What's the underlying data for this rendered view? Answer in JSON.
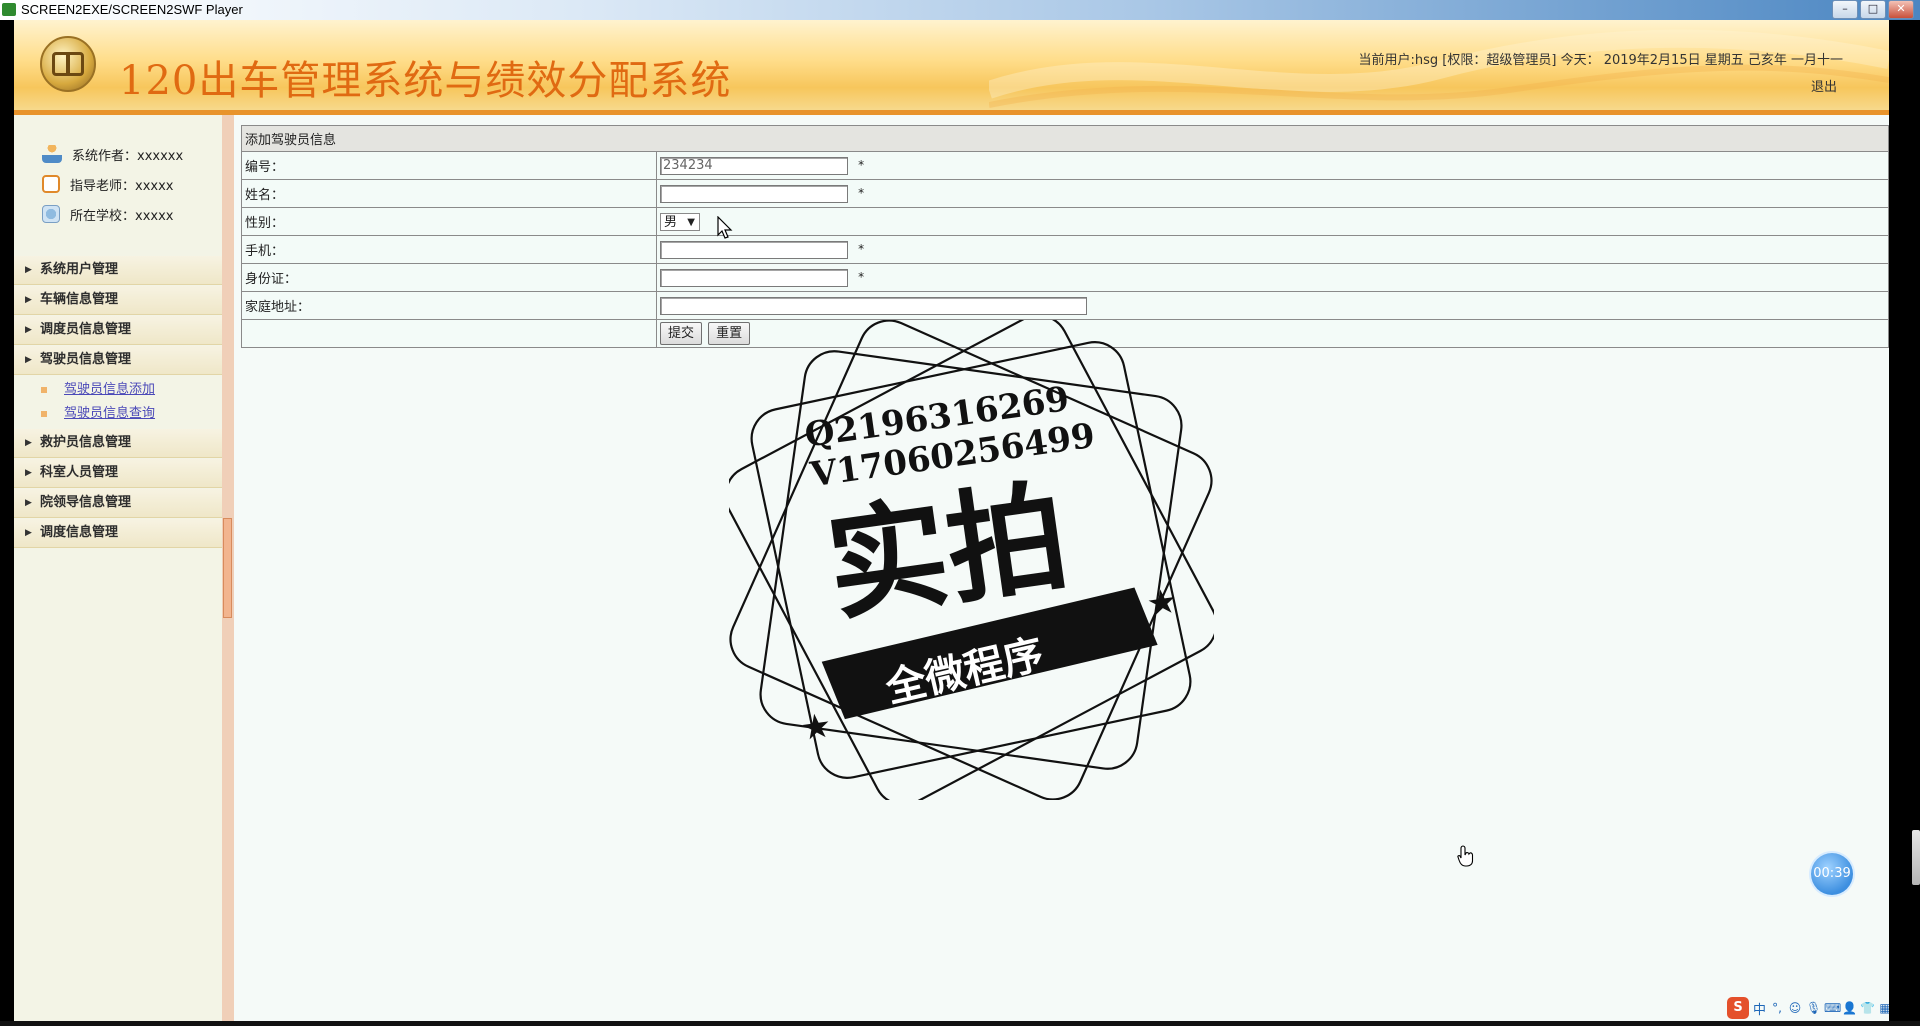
{
  "window": {
    "title": "SCREEN2EXE/SCREEN2SWF Player",
    "controls": {
      "minimize": "–",
      "maximize": "□",
      "close": "✕"
    }
  },
  "header": {
    "app_title": "120出车管理系统与绩效分配系统",
    "user_info": "当前用户:hsg [权限：超级管理员] 今天： 2019年2月15日 星期五 己亥年 一月十一",
    "logout": "退出"
  },
  "sidebar": {
    "info": [
      {
        "label": "系统作者：xxxxxx",
        "icon": "user-icon"
      },
      {
        "label": "指导老师：xxxxx",
        "icon": "alarm-clock-icon"
      },
      {
        "label": "所在学校：xxxxx",
        "icon": "globe-icon"
      }
    ],
    "menu": [
      {
        "label": "系统用户管理"
      },
      {
        "label": "车辆信息管理"
      },
      {
        "label": "调度员信息管理"
      },
      {
        "label": "驾驶员信息管理",
        "expanded": true,
        "children": [
          {
            "label": "驾驶员信息添加"
          },
          {
            "label": "驾驶员信息查询"
          }
        ]
      },
      {
        "label": "救护员信息管理"
      },
      {
        "label": "科室人员管理"
      },
      {
        "label": "院领导信息管理"
      },
      {
        "label": "调度信息管理"
      }
    ]
  },
  "form": {
    "title": "添加驾驶员信息",
    "fields": {
      "number": {
        "label": "编号：",
        "value": "234234",
        "required": "*"
      },
      "name": {
        "label": "姓名：",
        "value": "",
        "required": "*"
      },
      "gender": {
        "label": "性别：",
        "selected": "男"
      },
      "phone": {
        "label": "手机：",
        "value": "",
        "required": "*"
      },
      "id_card": {
        "label": "身份证：",
        "value": "",
        "required": "*"
      },
      "address": {
        "label": "家庭地址：",
        "value": ""
      }
    },
    "submit_label": "提交",
    "reset_label": "重置"
  },
  "watermark": {
    "line1": "Q2196316269",
    "line2": "V17060256499",
    "main": "实拍",
    "banner": "全微程序"
  },
  "overlay": {
    "timer": "00:39",
    "ime_label": "中"
  },
  "colors": {
    "title_orange": "#e06a12",
    "header_border": "#e8932b",
    "link_purple": "#4b49b8"
  }
}
